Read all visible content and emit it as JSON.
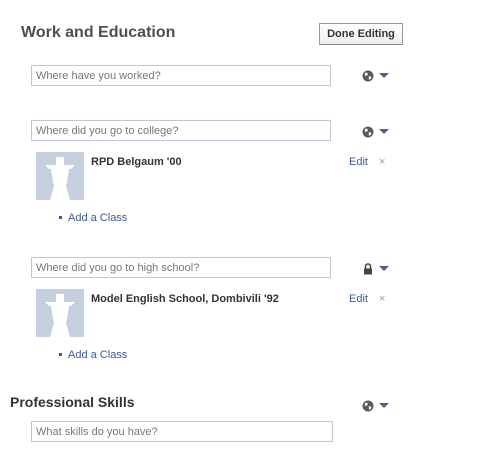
{
  "header": {
    "title": "Work and Education",
    "done_button_label": "Done Editing"
  },
  "work": {
    "placeholder": "Where have you worked?",
    "privacy_icon": "globe-icon"
  },
  "college": {
    "placeholder": "Where did you go to college?",
    "privacy_icon": "globe-icon",
    "entry": {
      "name": "RPD Belgaum '00",
      "edit_label": "Edit",
      "remove_label": "×",
      "add_class_label": "Add a Class"
    }
  },
  "high_school": {
    "placeholder": "Where did you go to high school?",
    "privacy_icon": "lock-icon",
    "entry": {
      "name": "Model English School, Dombivili '92",
      "edit_label": "Edit",
      "remove_label": "×",
      "add_class_label": "Add a Class"
    }
  },
  "skills": {
    "title": "Professional Skills",
    "placeholder": "What skills do you have?",
    "privacy_icon": "globe-icon"
  },
  "colors": {
    "link": "#3b5998",
    "input_border": "#bdc7d8",
    "photo_bg": "#c6cfe0",
    "text": "#333333"
  }
}
